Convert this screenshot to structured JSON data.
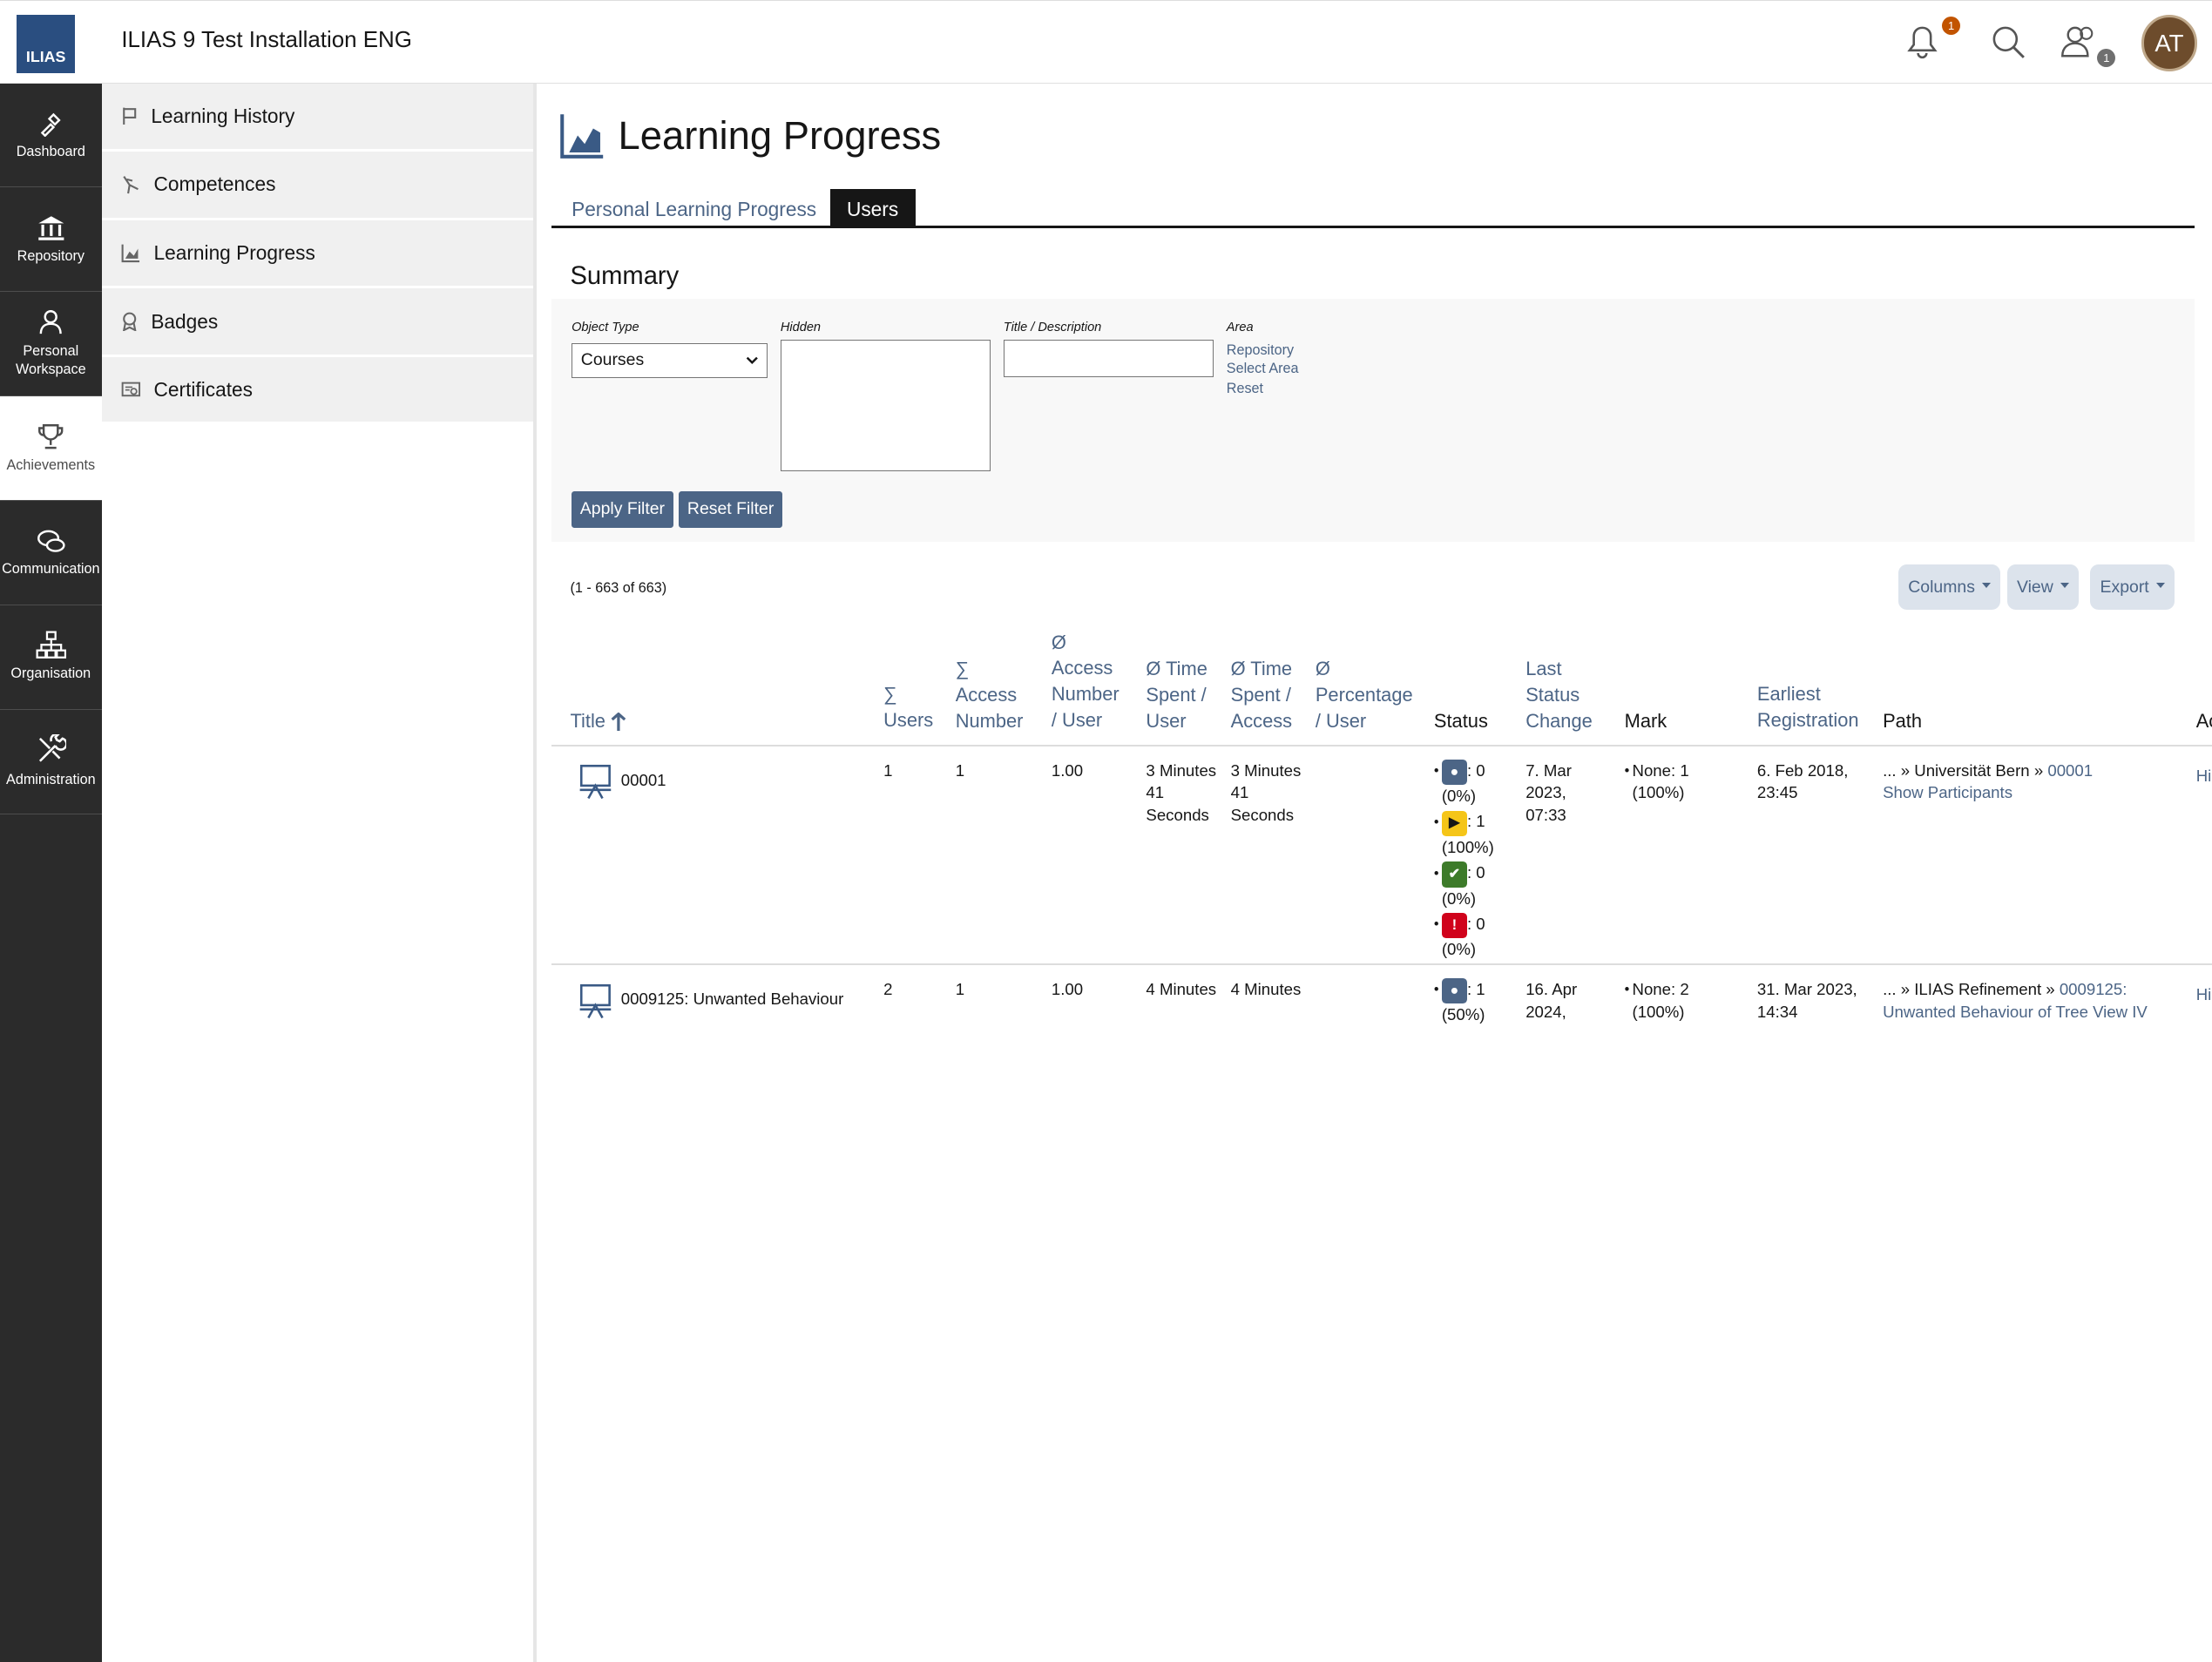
{
  "header": {
    "logo_text": "ILIAS",
    "installation_title": "ILIAS 9 Test Installation ENG",
    "notifications_count": "1",
    "contacts_count": "1",
    "avatar_initials": "AT"
  },
  "mainbar": {
    "items": [
      {
        "label": "Dashboard",
        "icon": "dashboard-icon"
      },
      {
        "label": "Repository",
        "icon": "repository-icon"
      },
      {
        "label": "Personal Workspace",
        "icon": "personal-workspace-icon"
      },
      {
        "label": "Achievements",
        "icon": "trophy-icon"
      },
      {
        "label": "Communication",
        "icon": "communication-icon"
      },
      {
        "label": "Organisation",
        "icon": "organisation-icon"
      },
      {
        "label": "Administration",
        "icon": "administration-icon"
      }
    ]
  },
  "slate": {
    "items": [
      {
        "label": "Learning History"
      },
      {
        "label": "Competences"
      },
      {
        "label": "Learning Progress"
      },
      {
        "label": "Badges"
      },
      {
        "label": "Certificates"
      }
    ]
  },
  "page": {
    "title": "Learning Progress",
    "tabs": [
      "Personal Learning Progress",
      "Users"
    ],
    "summary_title": "Summary"
  },
  "filter": {
    "object_type_label": "Object Type",
    "object_type_value": "Courses",
    "hidden_label": "Hidden",
    "title_desc_label": "Title / Description",
    "area_label": "Area",
    "area_links": [
      "Repository",
      "Select Area",
      "Reset"
    ],
    "apply_label": "Apply Filter",
    "reset_label": "Reset Filter"
  },
  "table": {
    "count_text": "(1 - 663 of 663)",
    "columns_btn": "Columns",
    "view_btn": "View",
    "export_btn": "Export",
    "headers": {
      "title": "Title",
      "users": "∑ Users",
      "access_number": "∑ Access Number",
      "avg_access_user": "Ø Access Number / User",
      "avg_time_user": "Ø Time Spent / User",
      "avg_time_access": "Ø Time Spent / Access",
      "avg_percentage": "Ø Percentage / User",
      "status": "Status",
      "last_status_change": "Last Status Change",
      "mark": "Mark",
      "earliest_registration": "Earliest Registration",
      "path": "Path",
      "actions": "Ac"
    },
    "rows": [
      {
        "title": "00001",
        "users": "1",
        "access_number": "1",
        "avg_access": "1.00",
        "time_user": "3 Minutes 41 Seconds",
        "time_access": "3 Minutes 41 Seconds",
        "status": [
          {
            "count": ": 0",
            "pct": "(0%)"
          },
          {
            "count": ": 1",
            "pct": "(100%)"
          },
          {
            "count": ": 0",
            "pct": "(0%)"
          },
          {
            "count": ": 0",
            "pct": "(0%)"
          }
        ],
        "last_change": "7. Mar 2023, 07:33",
        "mark": "None: 1 (100%)",
        "earliest": "6. Feb 2018, 23:45",
        "path_prefix": "... » Universität Bern » ",
        "path_link": "00001",
        "show_participants": "Show Participants",
        "action": "Hi"
      },
      {
        "title": "0009125: Unwanted Behaviour",
        "users": "2",
        "access_number": "1",
        "avg_access": "1.00",
        "time_user": "4 Minutes",
        "time_access": "4 Minutes",
        "status": [
          {
            "count": ": 1",
            "pct": "(50%)"
          }
        ],
        "last_change": "16. Apr 2024,",
        "mark": "None: 2 (100%)",
        "earliest": "31. Mar 2023, 14:34",
        "path_prefix": "... » ILIAS Refinement » ",
        "path_link": "0009125: Unwanted Behaviour of Tree View IV",
        "action": "Hi"
      }
    ]
  }
}
